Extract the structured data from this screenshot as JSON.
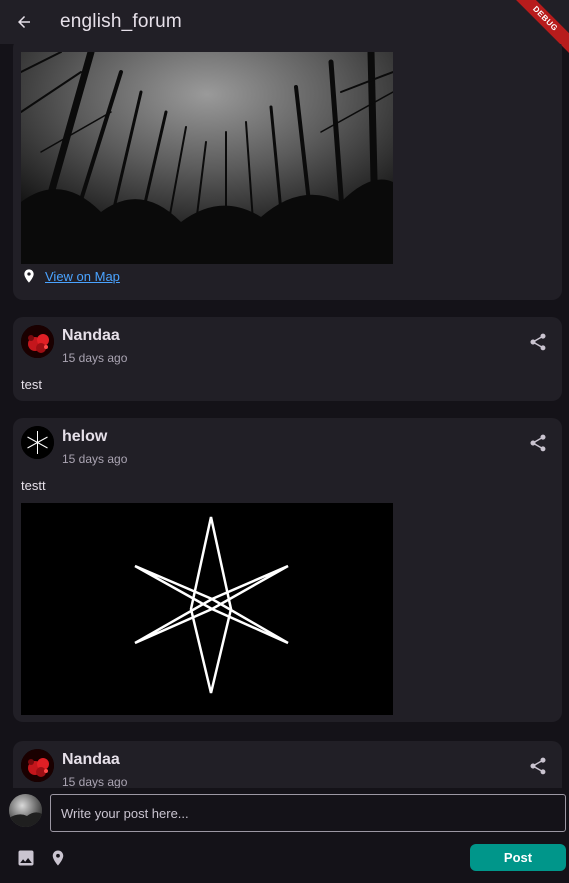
{
  "appbar": {
    "title": "english_forum",
    "debug_banner": "DEBUG"
  },
  "posts": [
    {
      "map_link": "View on Map"
    },
    {
      "author": "Nandaa",
      "time": "15 days ago",
      "text": "test"
    },
    {
      "author": "helow",
      "time": "15 days ago",
      "text": "testt"
    },
    {
      "author": "Nandaa",
      "time": "15 days ago"
    }
  ],
  "composer": {
    "placeholder": "Write your post here...",
    "value": ""
  },
  "post_button": "Post",
  "icons": {
    "back": "arrow-left-icon",
    "share": "share-icon",
    "location": "location-pin-icon",
    "image": "image-icon"
  },
  "colors": {
    "accent": "#00968a",
    "link": "#4aa3ff",
    "background": "#141218",
    "card": "#211f26"
  }
}
